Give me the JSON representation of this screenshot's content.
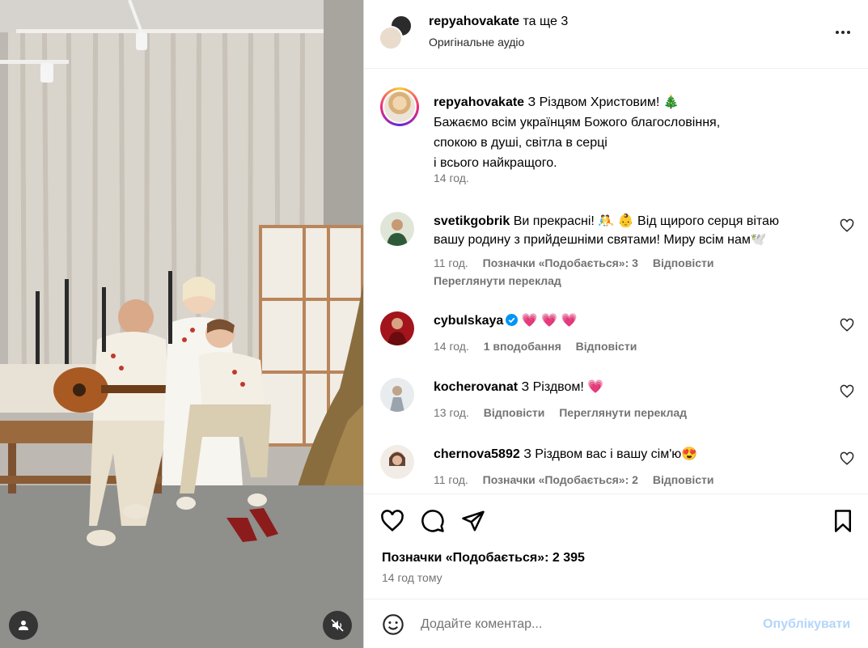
{
  "header": {
    "username": "repyahovakate",
    "coauthors": "та ще 3",
    "audio": "Оригінальне аудіо",
    "more_icon": "more-horizontal-icon"
  },
  "caption": {
    "username": "repyahovakate",
    "line1": "З Різдвом Христовим! 🎄",
    "line2": "Бажаємо всім українцям Божого благословіння,",
    "line3": "спокою в душі, світла в серці",
    "line4": "і всього найкращого.",
    "time": "14 год."
  },
  "comments": [
    {
      "username": "svetikgobrik",
      "text_line1": "Ви прекрасні! 🤼 👶 Від щирого серця вітаю",
      "text_line2": "вашу родину з прийдешніми святами! Миру всім нам🕊️",
      "time": "11 год.",
      "likes": "Позначки «Подобається»: 3",
      "reply": "Відповісти",
      "translate": "Переглянути переклад"
    },
    {
      "username": "cybulskaya",
      "text": "💗 💗 💗",
      "time": "14 год.",
      "likes": "1 вподобання",
      "reply": "Відповісти"
    },
    {
      "username": "kocherovanat",
      "text": "З Різдвом! 💗",
      "time": "13 год.",
      "reply": "Відповісти",
      "translate": "Переглянути переклад"
    },
    {
      "username": "chernova5892",
      "text": "З Різдвом вас і вашу сім'ю😍",
      "time": "11 год.",
      "likes": "Позначки «Подобається»: 2",
      "reply": "Відповісти"
    }
  ],
  "actions": {
    "likes_count": "Позначки «Подобається»: 2 395",
    "posted": "14 год тому"
  },
  "composer": {
    "placeholder": "Додайте коментар...",
    "publish": "Опублікувати"
  },
  "colors": {
    "publish_disabled": "#b3d6f9",
    "muted_text": "#737373",
    "verified": "#0095f6",
    "heart": "#ed1d5b"
  }
}
